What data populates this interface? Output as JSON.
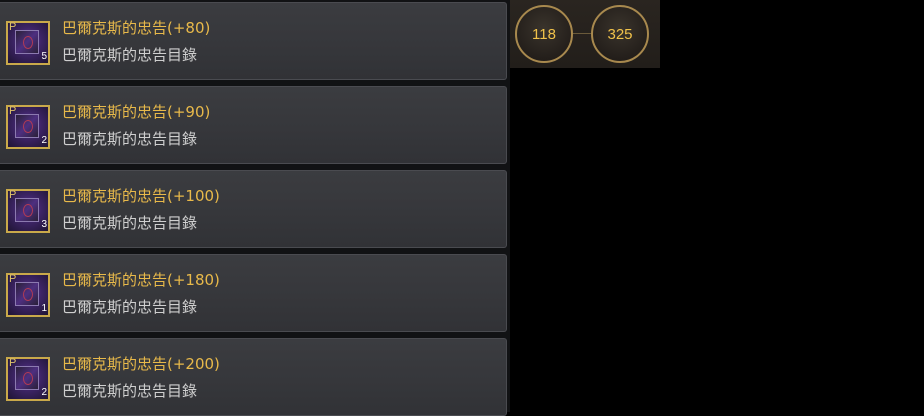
{
  "items": [
    {
      "name": "巴爾克斯的忠告(+80)",
      "subtitle": "巴爾克斯的忠告目錄",
      "rank": "P",
      "quantity": "5",
      "icon": "scroll-book-icon"
    },
    {
      "name": "巴爾克斯的忠告(+90)",
      "subtitle": "巴爾克斯的忠告目錄",
      "rank": "P",
      "quantity": "2",
      "icon": "scroll-book-icon"
    },
    {
      "name": "巴爾克斯的忠告(+100)",
      "subtitle": "巴爾克斯的忠告目錄",
      "rank": "P",
      "quantity": "3",
      "icon": "scroll-book-icon"
    },
    {
      "name": "巴爾克斯的忠告(+180)",
      "subtitle": "巴爾克斯的忠告目錄",
      "rank": "P",
      "quantity": "1",
      "icon": "scroll-book-icon"
    },
    {
      "name": "巴爾克斯的忠告(+200)",
      "subtitle": "巴爾克斯的忠告目錄",
      "rank": "P",
      "quantity": "2",
      "icon": "scroll-book-icon"
    }
  ],
  "stats": [
    {
      "value": "118"
    },
    {
      "value": "325"
    }
  ],
  "colors": {
    "item_name": "#e8b94a",
    "item_subtitle": "#cfcfcf",
    "icon_border": "#c9a94a",
    "stat_text": "#f0c24a",
    "stat_ring": "#a8894e"
  }
}
